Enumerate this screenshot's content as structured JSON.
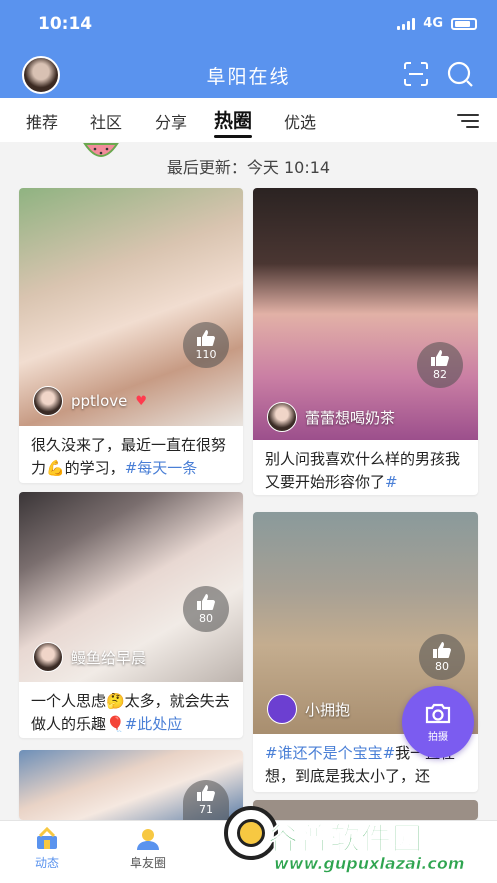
{
  "status_bar": {
    "time": "10:14",
    "network": "4G"
  },
  "header": {
    "title": "阜阳在线"
  },
  "tabs": [
    {
      "label": "推荐"
    },
    {
      "label": "社区"
    },
    {
      "label": "分享"
    },
    {
      "label": "热圈"
    },
    {
      "label": "优选"
    }
  ],
  "active_tab": "热圈",
  "update": {
    "text": "最后更新：今天 10:14"
  },
  "cards": [
    {
      "likes": "110",
      "author": "pptlove",
      "desc_text": "很久没来了，最近一直在很努力💪的学习，",
      "tag": "#每天一条"
    },
    {
      "likes": "82",
      "author": "蕾蕾想喝奶茶",
      "desc_text": "别人问我喜欢什么样的男孩我又要开始形容你了",
      "tag": "#"
    },
    {
      "likes": "80",
      "author": "鳗鱼给早晨",
      "desc_text": "一个人思虑🤔太多，就会失去做人的乐趣🎈",
      "tag": "#此处应"
    },
    {
      "likes": "80",
      "author": "小拥抱",
      "tag": "#谁还不是个宝宝#",
      "desc_text": "我一直在想，到底是我太小了，还"
    },
    {
      "likes": "71"
    }
  ],
  "fab": {
    "label": "拍摄"
  },
  "bottom_nav": [
    {
      "label": "动态"
    },
    {
      "label": "阜友圈"
    }
  ],
  "watermark": {
    "brand": "谷普软件园",
    "url": "www.gupuxlazai.com"
  },
  "colors": {
    "primary": "#5a93ee",
    "tag": "#4a7fd6",
    "fab": "#7b5cf0",
    "watermark": "#2ea44f"
  }
}
